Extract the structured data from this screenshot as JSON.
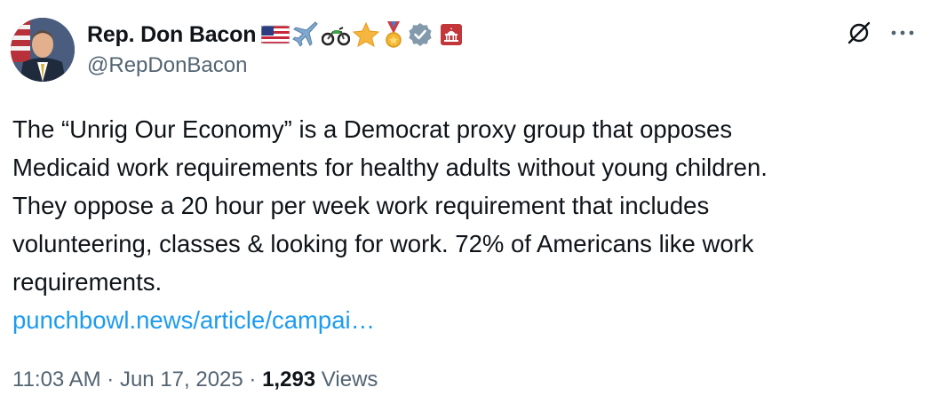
{
  "author": {
    "display_name": "Rep. Don Bacon",
    "handle": "@RepDonBacon",
    "badges": [
      "us-flag-icon",
      "airplane-icon",
      "motorcycle-icon",
      "star-icon",
      "medal-icon",
      "verified-badge-icon",
      "capitol-building-icon"
    ],
    "verified_color": "#829aab"
  },
  "actions": {
    "grok_icon": "grok-slash-icon",
    "more_label": "···"
  },
  "post": {
    "lines": [
      "The “Unrig Our Economy” is a Democrat proxy group that opposes",
      "Medicaid work requirements for healthy adults without young children.",
      "They oppose a 20 hour per week work requirement that includes",
      "volunteering, classes & looking for work. 72% of Americans like work",
      "requirements."
    ],
    "link": "punchbowl.news/article/campai…",
    "link_color": "#1d9bf0"
  },
  "meta": {
    "time": "11:03 AM",
    "separator": " · ",
    "date": "Jun 17, 2025",
    "separator2": " · ",
    "views_count": "1,293",
    "views_label": " Views"
  }
}
